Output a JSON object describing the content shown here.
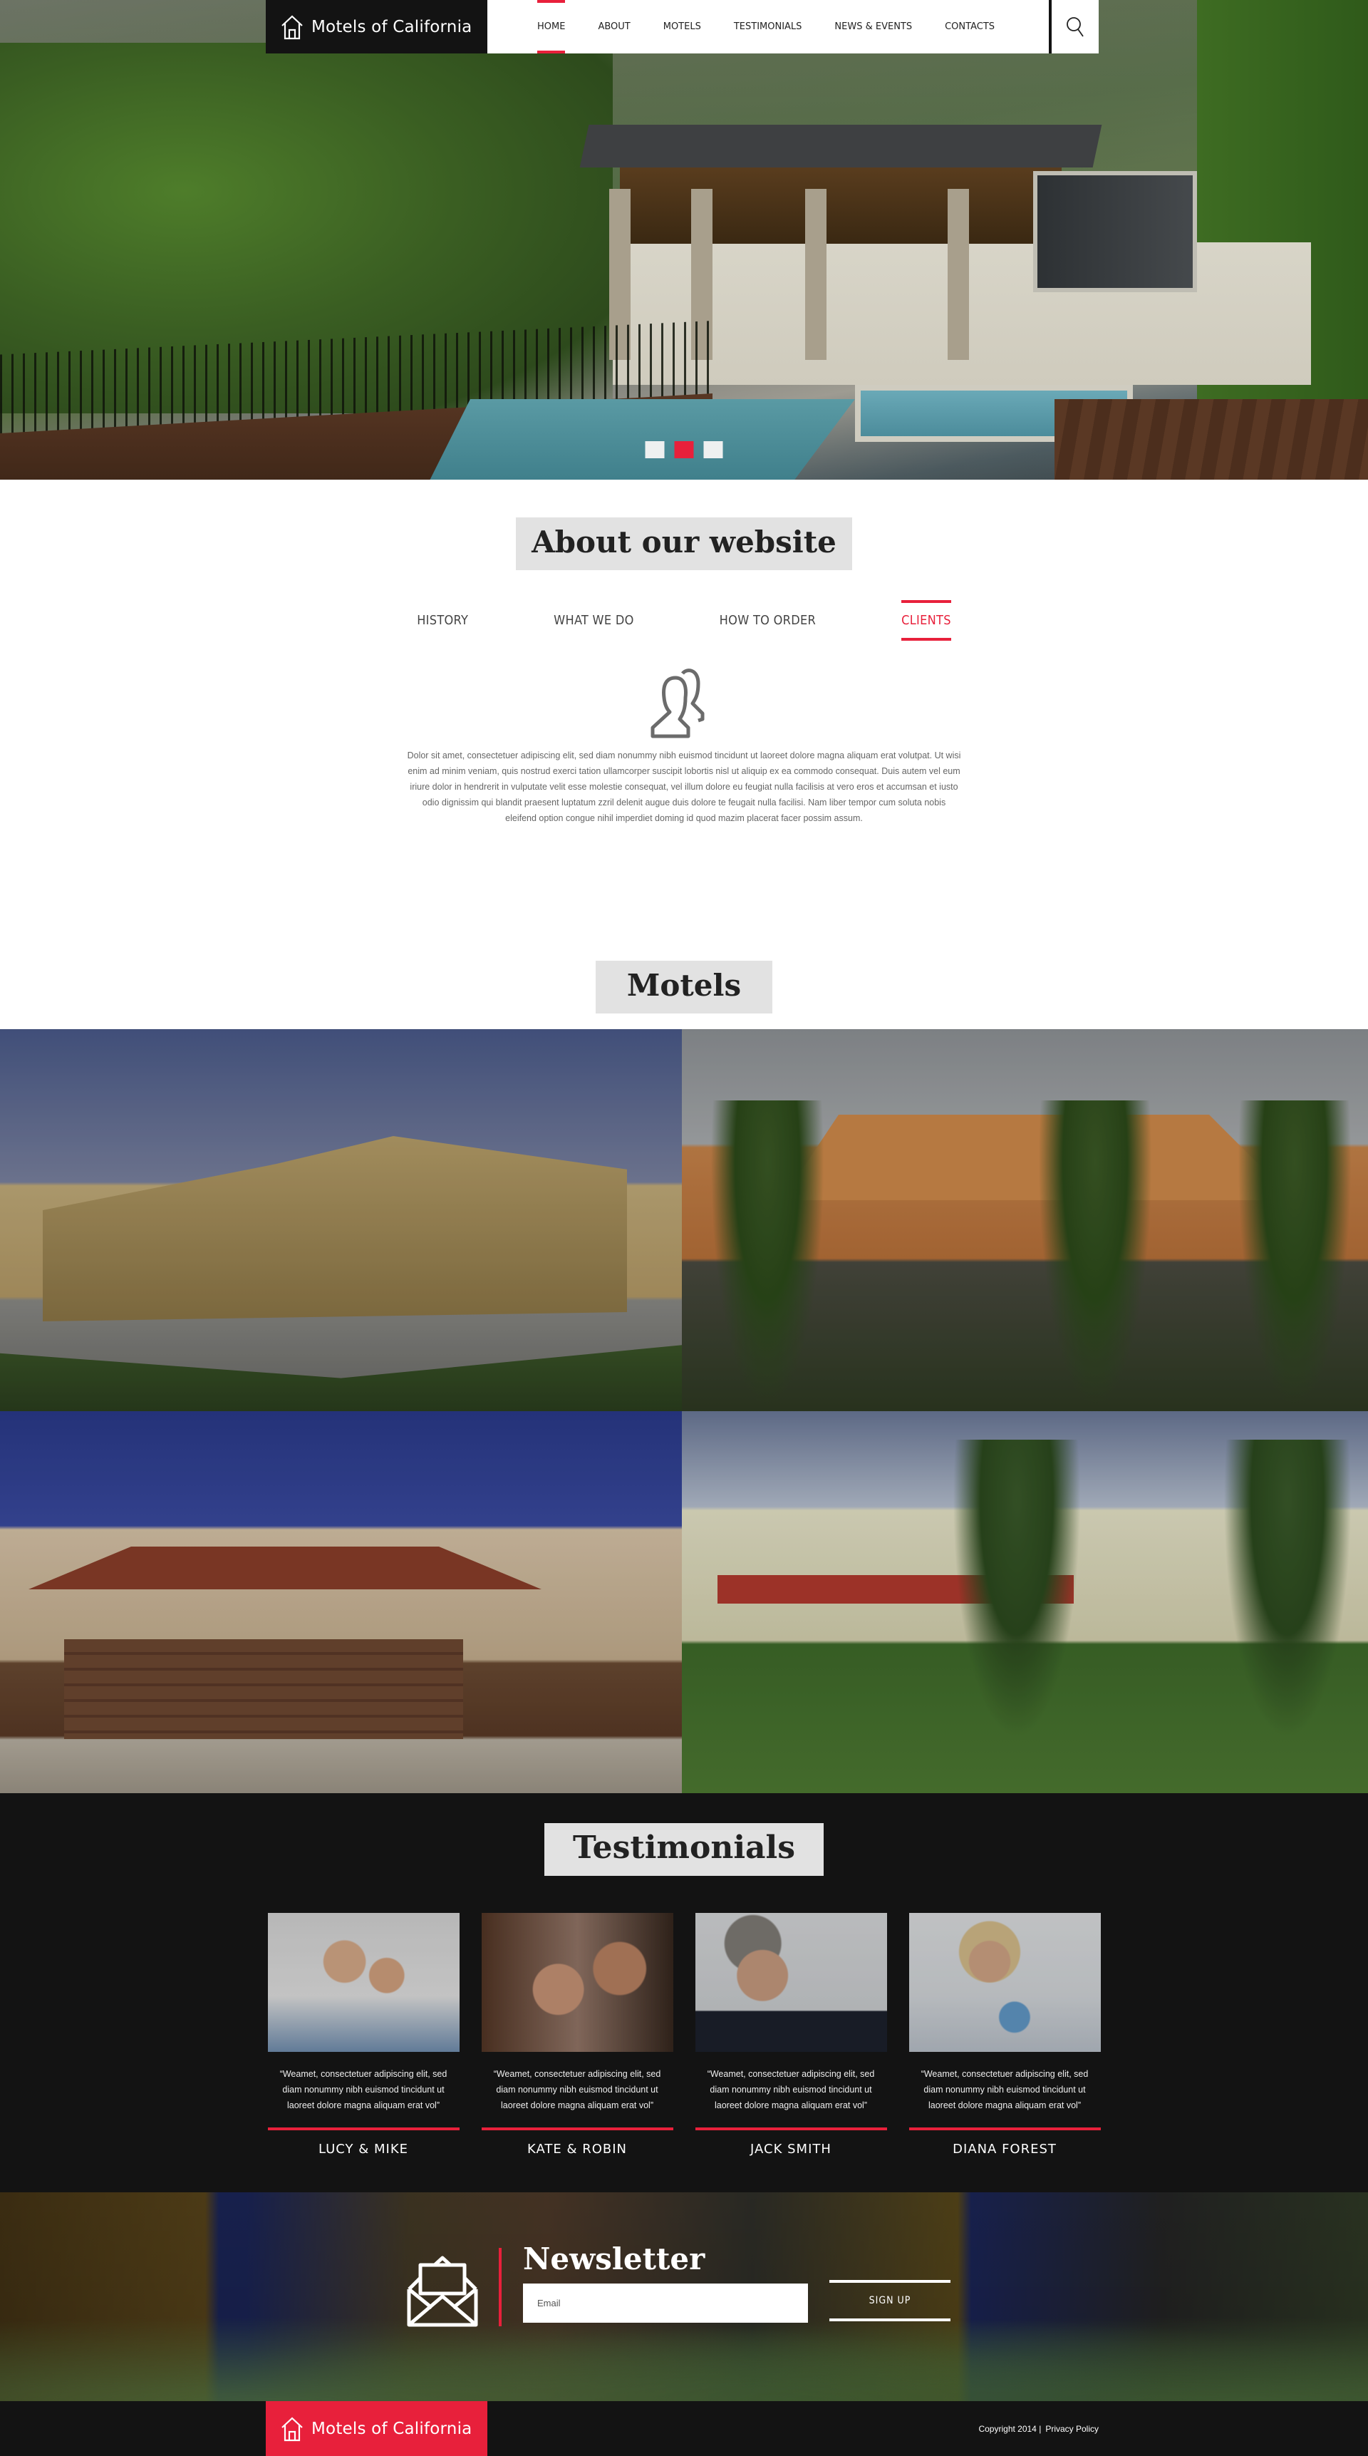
{
  "brand": {
    "name": "Motels of California",
    "icon": "house-icon",
    "accent_color": "#e8203b",
    "dark_color": "#131313"
  },
  "nav": {
    "items": [
      {
        "label": "HOME",
        "active": true
      },
      {
        "label": "ABOUT",
        "active": false
      },
      {
        "label": "MOTELS",
        "active": false
      },
      {
        "label": "TESTIMONIALS",
        "active": false
      },
      {
        "label": "NEWS & EVENTS",
        "active": false
      },
      {
        "label": "CONTACTS",
        "active": false
      }
    ],
    "search_icon": "search-icon"
  },
  "hero": {
    "slides": 3,
    "active_slide": 2
  },
  "about": {
    "title": "About our website",
    "tabs": [
      {
        "label": "HISTORY",
        "active": false
      },
      {
        "label": "WHAT WE DO",
        "active": false
      },
      {
        "label": "HOW TO ORDER",
        "active": false
      },
      {
        "label": "CLIENTS",
        "active": true
      }
    ],
    "icon": "users-icon",
    "text": "Dolor sit amet, consectetuer adipiscing elit, sed diam nonummy nibh euismod tincidunt ut laoreet dolore magna aliquam erat volutpat. Ut wisi enim ad minim veniam, quis nostrud exerci tation ullamcorper suscipit lobortis nisl ut aliquip ex ea commodo consequat. Duis autem vel eum iriure dolor in hendrerit in vulputate velit esse molestie consequat, vel illum dolore eu feugiat nulla facilisis at vero eros et accumsan et iusto odio dignissim qui blandit praesent luptatum zzril delenit augue duis dolore te feugait nulla facilisi. Nam liber tempor cum soluta nobis eleifend option congue nihil imperdiet doming id quod mazim placerat facer possim assum."
  },
  "motels": {
    "title": "Motels",
    "items": [
      {
        "name": "motel-1"
      },
      {
        "name": "motel-2"
      },
      {
        "name": "motel-3"
      },
      {
        "name": "motel-4"
      }
    ]
  },
  "testimonials": {
    "title": "Testimonials",
    "items": [
      {
        "name": "LUCY & MIKE",
        "quote": "“Weamet, consectetuer adipiscing elit, sed diam nonummy nibh euismod tincidunt ut laoreet dolore magna aliquam erat vol”"
      },
      {
        "name": "KATE & ROBIN",
        "quote": "“Weamet, consectetuer adipiscing elit, sed diam nonummy nibh euismod tincidunt ut laoreet dolore magna aliquam erat vol”"
      },
      {
        "name": "JACK SMITH",
        "quote": "“Weamet, consectetuer adipiscing elit, sed diam nonummy nibh euismod tincidunt ut laoreet dolore magna aliquam erat vol”"
      },
      {
        "name": "DIANA FOREST",
        "quote": "“Weamet, consectetuer adipiscing elit, sed diam nonummy nibh euismod tincidunt ut laoreet dolore magna aliquam erat vol”"
      }
    ]
  },
  "newsletter": {
    "title": "Newsletter",
    "icon": "envelope-open-icon",
    "email_placeholder": "Email",
    "email_value": "",
    "button_label": "SIGN UP"
  },
  "footer": {
    "brand": "Motels of California",
    "copyright": "Copyright 2014 |",
    "privacy_label": "Privacy Policy"
  }
}
